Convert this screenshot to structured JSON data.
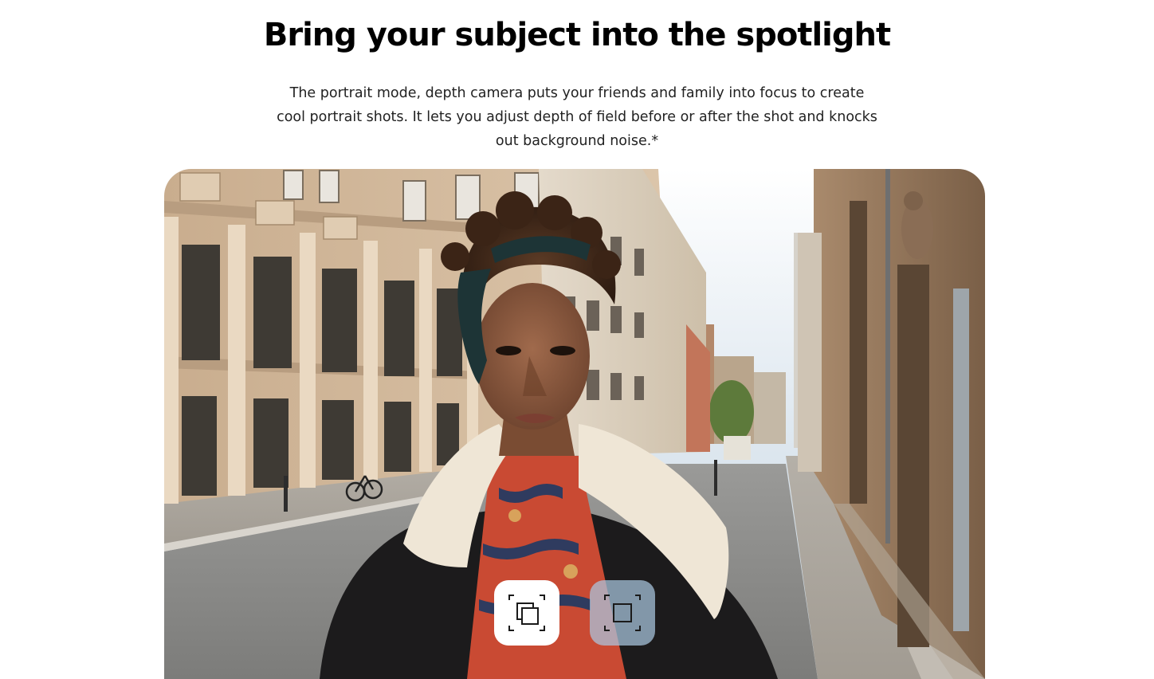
{
  "headline": "Bring your subject into the spotlight",
  "description": "The portrait mode, depth camera puts your friends and family into focus to create cool portrait shots. It lets you adjust depth of field before or after the shot and knocks out background noise.*",
  "photo": {
    "subject": "portrait-on-city-street",
    "toggles": [
      {
        "icon": "focus-frames-icon",
        "state": "selected"
      },
      {
        "icon": "single-frame-icon",
        "state": "unselected"
      }
    ]
  },
  "colors": {
    "text": "#000000",
    "toggle_active_bg": "#ffffff",
    "toggle_inactive_bg": "#aac8e1"
  }
}
